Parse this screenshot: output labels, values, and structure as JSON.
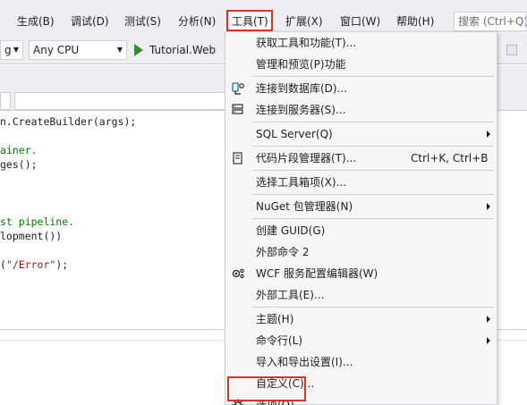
{
  "menubar": {
    "items": [
      {
        "label": "生成(B)"
      },
      {
        "label": "调试(D)"
      },
      {
        "label": "测试(S)"
      },
      {
        "label": "分析(N)"
      },
      {
        "label": "工具(T)"
      },
      {
        "label": "扩展(X)"
      },
      {
        "label": "窗口(W)"
      },
      {
        "label": "帮助(H)"
      }
    ],
    "search_placeholder": "搜索 (Ctrl+Q)"
  },
  "toolbar": {
    "config_value": "g",
    "platform_value": "Any CPU",
    "run_label": "Tutorial.Web"
  },
  "editor": {
    "lines": [
      {
        "segments": [
          {
            "text": "n.CreateBuilder(args);",
            "cls": ""
          }
        ]
      },
      {
        "segments": [
          {
            "text": "",
            "cls": ""
          }
        ]
      },
      {
        "segments": [
          {
            "text": "ainer.",
            "cls": "cmt"
          }
        ]
      },
      {
        "segments": [
          {
            "text": "ges();",
            "cls": ""
          }
        ]
      },
      {
        "segments": [
          {
            "text": "",
            "cls": ""
          }
        ]
      },
      {
        "segments": [
          {
            "text": "",
            "cls": ""
          }
        ]
      },
      {
        "segments": [
          {
            "text": "",
            "cls": ""
          }
        ]
      },
      {
        "segments": [
          {
            "text": "st pipeline.",
            "cls": "cmt"
          }
        ]
      },
      {
        "segments": [
          {
            "text": "lopment())",
            "cls": ""
          }
        ]
      },
      {
        "segments": [
          {
            "text": "",
            "cls": ""
          }
        ]
      },
      {
        "segments": [
          {
            "text": "(",
            "cls": ""
          },
          {
            "text": "\"/Error\"",
            "cls": "str"
          },
          {
            "text": ");",
            "cls": ""
          }
        ]
      }
    ]
  },
  "tools_menu": {
    "items": [
      {
        "type": "item",
        "label": "获取工具和功能(T)...",
        "icon": ""
      },
      {
        "type": "item",
        "label": "管理和预览(P)功能",
        "icon": ""
      },
      {
        "type": "sep"
      },
      {
        "type": "item",
        "label": "连接到数据库(D)...",
        "icon": "database-connect-icon"
      },
      {
        "type": "item",
        "label": "连接到服务器(S)...",
        "icon": "server-connect-icon"
      },
      {
        "type": "sep"
      },
      {
        "type": "item",
        "label": "SQL Server(Q)",
        "icon": "",
        "submenu": true
      },
      {
        "type": "sep"
      },
      {
        "type": "item",
        "label": "代码片段管理器(T)...",
        "icon": "snippet-icon",
        "shortcut": "Ctrl+K, Ctrl+B"
      },
      {
        "type": "sep"
      },
      {
        "type": "item",
        "label": "选择工具箱项(X)...",
        "icon": ""
      },
      {
        "type": "sep"
      },
      {
        "type": "item",
        "label": "NuGet 包管理器(N)",
        "icon": "",
        "submenu": true
      },
      {
        "type": "sep"
      },
      {
        "type": "item",
        "label": "创建 GUID(G)",
        "icon": ""
      },
      {
        "type": "item",
        "label": "外部命令 2",
        "icon": ""
      },
      {
        "type": "item",
        "label": "WCF 服务配置编辑器(W)",
        "icon": "wcf-config-icon"
      },
      {
        "type": "item",
        "label": "外部工具(E)...",
        "icon": ""
      },
      {
        "type": "sep"
      },
      {
        "type": "item",
        "label": "主题(H)",
        "icon": "",
        "submenu": true
      },
      {
        "type": "item",
        "label": "命令行(L)",
        "icon": "",
        "submenu": true
      },
      {
        "type": "item",
        "label": "导入和导出设置(I)...",
        "icon": ""
      },
      {
        "type": "item",
        "label": "自定义(C)...",
        "icon": ""
      },
      {
        "type": "item",
        "label": "选项(O)...",
        "icon": "gear-icon"
      }
    ]
  },
  "colors": {
    "highlight_box": "#e0302c",
    "run_green": "#388a34",
    "menu_bg": "#f6f6f6",
    "chrome_bg": "#eeeef2"
  }
}
